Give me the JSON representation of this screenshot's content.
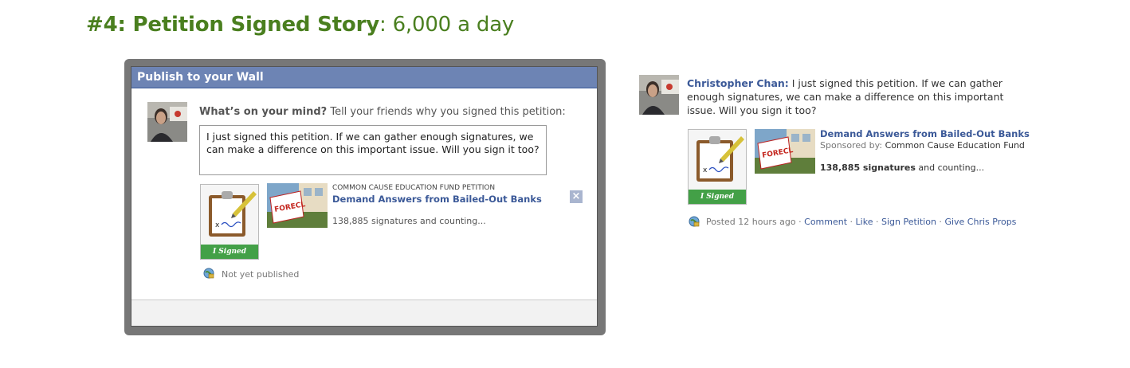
{
  "slide": {
    "title_bold": "#4: Petition Signed Story",
    "title_rest": ": 6,000 a day"
  },
  "dialog": {
    "header": "Publish to your Wall",
    "prompt_bold": "What’s on your mind?",
    "prompt_rest": " Tell your friends why you signed this petition:",
    "message": "I just signed this petition. If we can gather enough signatures, we can make a difference on this important issue. Will you sign it too?",
    "badge_label": "I Signed",
    "petition_source": "Common Cause Education Fund Petition",
    "petition_title": "Demand Answers from Bailed-Out Banks",
    "signatures": "138,885 signatures and counting...",
    "close_icon": "×",
    "status": "Not yet published"
  },
  "story": {
    "author": "Christopher Chan:",
    "message": "I just signed this petition. If we can gather enough signatures, we can make a difference on this important issue. Will you sign it too?",
    "badge_label": "I Signed",
    "petition_title": "Demand Answers from Bailed-Out Banks",
    "sponsored_label": "Sponsored by:",
    "sponsor": "Common Cause Education Fund",
    "signatures_count": "138,885 signatures",
    "signatures_suffix": " and counting...",
    "posted": "Posted 12 hours ago",
    "sep": " · ",
    "actions": [
      "Comment",
      "Like",
      "Sign Petition",
      "Give Chris Props"
    ]
  },
  "colors": {
    "title_green": "#4a7f1f",
    "fb_blue": "#3b5998",
    "header_blue": "#6d84b4",
    "badge_green": "#43a047"
  },
  "icons": [
    "avatar",
    "clipboard-icon",
    "foreclosure-thumbnail",
    "close-icon",
    "globe-privacy-icon"
  ]
}
